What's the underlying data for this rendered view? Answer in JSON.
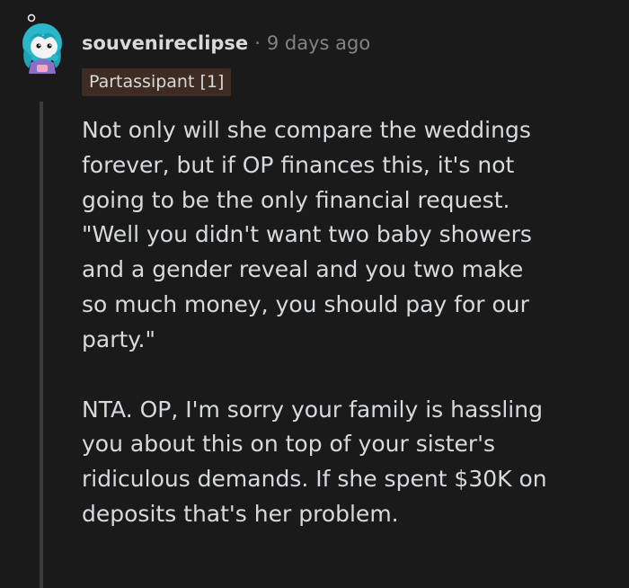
{
  "comment": {
    "username": "souvenireclipse",
    "separator": "·",
    "timestamp": "9 days ago",
    "flair": "Partassipant [1]",
    "paragraphs": [
      {
        "lines": [
          "Not only will she compare the weddings",
          "forever, but if OP finances this, it's not",
          "going to be the only financial request.",
          "\"Well you didn't want two baby showers",
          "and a gender reveal and you two make",
          "so much money, you should pay for our",
          "party.\""
        ]
      },
      {
        "lines": [
          "NTA. OP, I'm sorry your family is hassling",
          "you about this on top of your sister's",
          "ridiculous demands. If she spent $30K on",
          "deposits that's her problem."
        ]
      }
    ]
  },
  "colors": {
    "background": "#1a1a1b",
    "text": "#d7dadc",
    "meta": "#818384",
    "flair_bg": "#3e2c23",
    "thread_line": "#3a3a3c"
  }
}
